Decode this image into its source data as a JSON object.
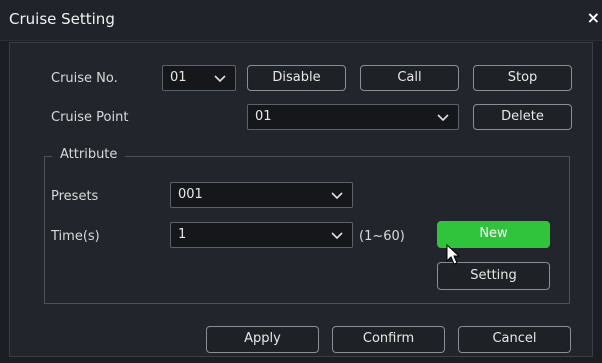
{
  "window": {
    "title": "Cruise Setting",
    "close_label": "×"
  },
  "cruise": {
    "number_label": "Cruise No.",
    "number_value": "01",
    "point_label": "Cruise Point",
    "point_value": "01",
    "disable_label": "Disable",
    "call_label": "Call",
    "stop_label": "Stop",
    "delete_label": "Delete"
  },
  "attribute": {
    "legend": "Attribute",
    "presets_label": "Presets",
    "presets_value": "001",
    "time_label": "Time(s)",
    "time_value": "1",
    "time_range": "(1~60)",
    "new_label": "New",
    "setting_label": "Setting"
  },
  "footer": {
    "apply_label": "Apply",
    "confirm_label": "Confirm",
    "cancel_label": "Cancel"
  },
  "colors": {
    "accent_green": "#2fc43c",
    "background": "#1b1e23",
    "panel": "#22262c"
  }
}
